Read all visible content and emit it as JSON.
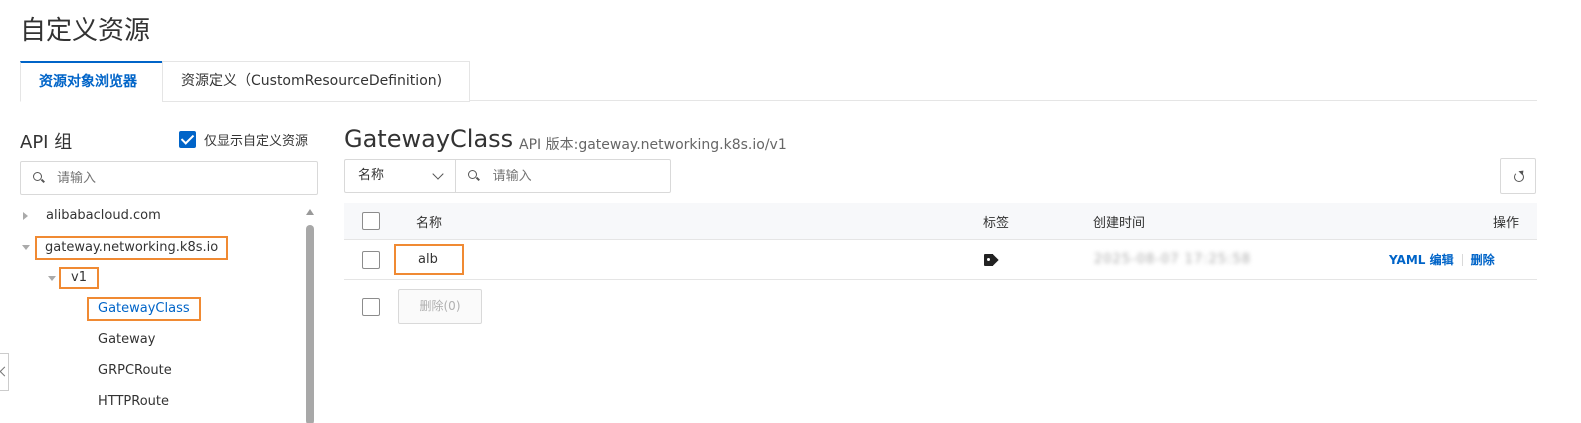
{
  "page": {
    "title": "自定义资源"
  },
  "tabs": [
    {
      "label": "资源对象浏览器",
      "active": true
    },
    {
      "label": "资源定义（CustomResourceDefinition)",
      "active": false
    }
  ],
  "sidebar": {
    "title": "API 组",
    "only_custom_checkbox": {
      "label": "仅显示自定义资源",
      "checked": true
    },
    "search": {
      "placeholder": "请输入"
    },
    "tree": {
      "groups": [
        {
          "label": "alibabacloud.com",
          "expanded": false
        },
        {
          "label": "gateway.networking.k8s.io",
          "expanded": true,
          "highlighted": true
        }
      ],
      "version": {
        "label": "v1",
        "expanded": true,
        "highlighted": true
      },
      "kinds": [
        {
          "label": "GatewayClass",
          "selected": true,
          "highlighted": true
        },
        {
          "label": "Gateway",
          "selected": false
        },
        {
          "label": "GRPCRoute",
          "selected": false
        },
        {
          "label": "HTTPRoute",
          "selected": false
        }
      ]
    }
  },
  "main": {
    "resource_title": "GatewayClass",
    "api_version": "API 版本:gateway.networking.k8s.io/v1",
    "filter": {
      "field": "名称",
      "placeholder": "请输入"
    },
    "table": {
      "columns": {
        "name": "名称",
        "labels": "标签",
        "created": "创建时间",
        "actions": "操作"
      },
      "rows": [
        {
          "name": "alb",
          "created": "2025-08-07 17:25:58",
          "highlighted": true
        }
      ],
      "row_actions": {
        "yaml_edit": "YAML 编辑",
        "delete": "删除"
      }
    },
    "bulk_delete_label": "删除(0)"
  },
  "colors": {
    "accent": "#0064c8",
    "highlight": "#f08a33"
  }
}
